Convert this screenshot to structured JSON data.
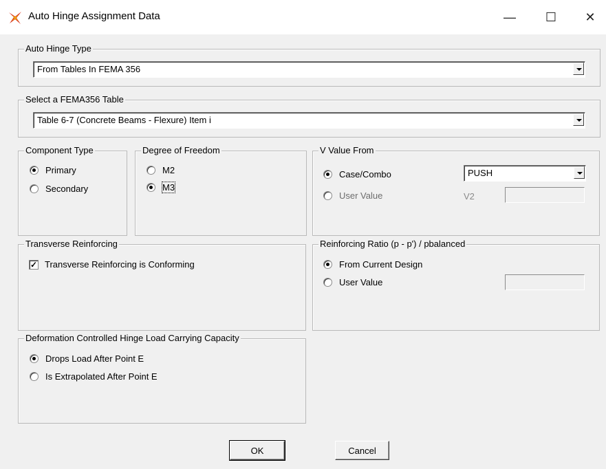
{
  "window": {
    "title": "Auto Hinge Assignment Data",
    "minimize_glyph": "—",
    "maximize_glyph": "☐",
    "close_glyph": "✕"
  },
  "auto_hinge_type": {
    "legend": "Auto Hinge Type",
    "selected": "From Tables In FEMA 356"
  },
  "fema_table": {
    "legend": "Select a FEMA356 Table",
    "selected": "Table 6-7 (Concrete Beams - Flexure) Item i"
  },
  "component_type": {
    "legend": "Component Type",
    "options": [
      {
        "label": "Primary",
        "selected": true
      },
      {
        "label": "Secondary",
        "selected": false
      }
    ]
  },
  "degree_of_freedom": {
    "legend": "Degree of Freedom",
    "options": [
      {
        "label": "M2",
        "selected": false
      },
      {
        "label": "M3",
        "selected": true
      }
    ]
  },
  "v_value_from": {
    "legend": "V Value From",
    "case_combo_label": "Case/Combo",
    "case_combo_selected": true,
    "case_combo_value": "PUSH",
    "user_value_label": "User Value",
    "user_value_selected": false,
    "v2_label": "V2",
    "v2_value": ""
  },
  "transverse_reinforcing": {
    "legend": "Transverse Reinforcing",
    "checkbox_label": "Transverse Reinforcing is Conforming",
    "checked": true
  },
  "reinforcing_ratio": {
    "legend": "Reinforcing Ratio  (p - p') / pbalanced",
    "from_design_label": "From Current Design",
    "from_design_selected": true,
    "user_value_label": "User Value",
    "user_value_selected": false,
    "user_value": ""
  },
  "deformation_capacity": {
    "legend": "Deformation Controlled Hinge Load Carrying Capacity",
    "options": [
      {
        "label": "Drops Load After Point E",
        "selected": true
      },
      {
        "label": "Is Extrapolated After Point E",
        "selected": false
      }
    ]
  },
  "buttons": {
    "ok": "OK",
    "cancel": "Cancel"
  },
  "colors": {
    "dialog_bg": "#f0f0f0",
    "titlebar_bg": "#ffffff",
    "icon_red": "#d9301b",
    "icon_yellow": "#f2c300"
  }
}
